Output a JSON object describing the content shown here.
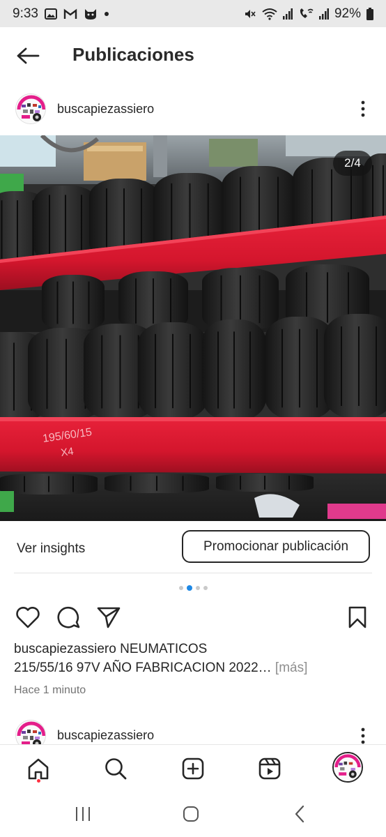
{
  "status_bar": {
    "time": "9:33",
    "battery": "92%",
    "left_icons": [
      "image-icon",
      "gmail-icon",
      "cat-app-icon",
      "dot-icon"
    ],
    "right_icons": [
      "mute-icon",
      "wifi-icon",
      "signal-icon",
      "wifi-call-icon",
      "signal-icon",
      "battery-icon"
    ]
  },
  "header": {
    "title": "Publicaciones",
    "back_icon": "arrow-left-icon"
  },
  "post": {
    "username": "buscapiezassiero",
    "image_counter": "2/4",
    "photo_subject": "tires-on-red-shelves",
    "insights_label": "Ver insights",
    "promote_label": "Promocionar publicación",
    "carousel": {
      "count": 4,
      "active_index": 1
    },
    "caption_username": "buscapiezassiero",
    "caption_line1": "NEUMATICOS",
    "caption_line2": "215/55/16 97V AÑO FABRICACION 2022…",
    "caption_more": "[más]",
    "timestamp": "Hace 1 minuto"
  },
  "next_post": {
    "username": "buscapiezassiero"
  },
  "actions": [
    "heart-icon",
    "comment-icon",
    "send-icon",
    "bookmark-icon"
  ],
  "bottom_nav": [
    "home-icon",
    "search-icon",
    "create-icon",
    "reels-icon",
    "profile-avatar"
  ],
  "system_nav": [
    "recents-icon",
    "home-circle-icon",
    "back-chevron-icon"
  ],
  "colors": {
    "accent_blue": "#1e88e5",
    "notification_red": "#ff3040",
    "text": "#262626",
    "muted": "#737373",
    "shelf_red": "#d8162e"
  }
}
